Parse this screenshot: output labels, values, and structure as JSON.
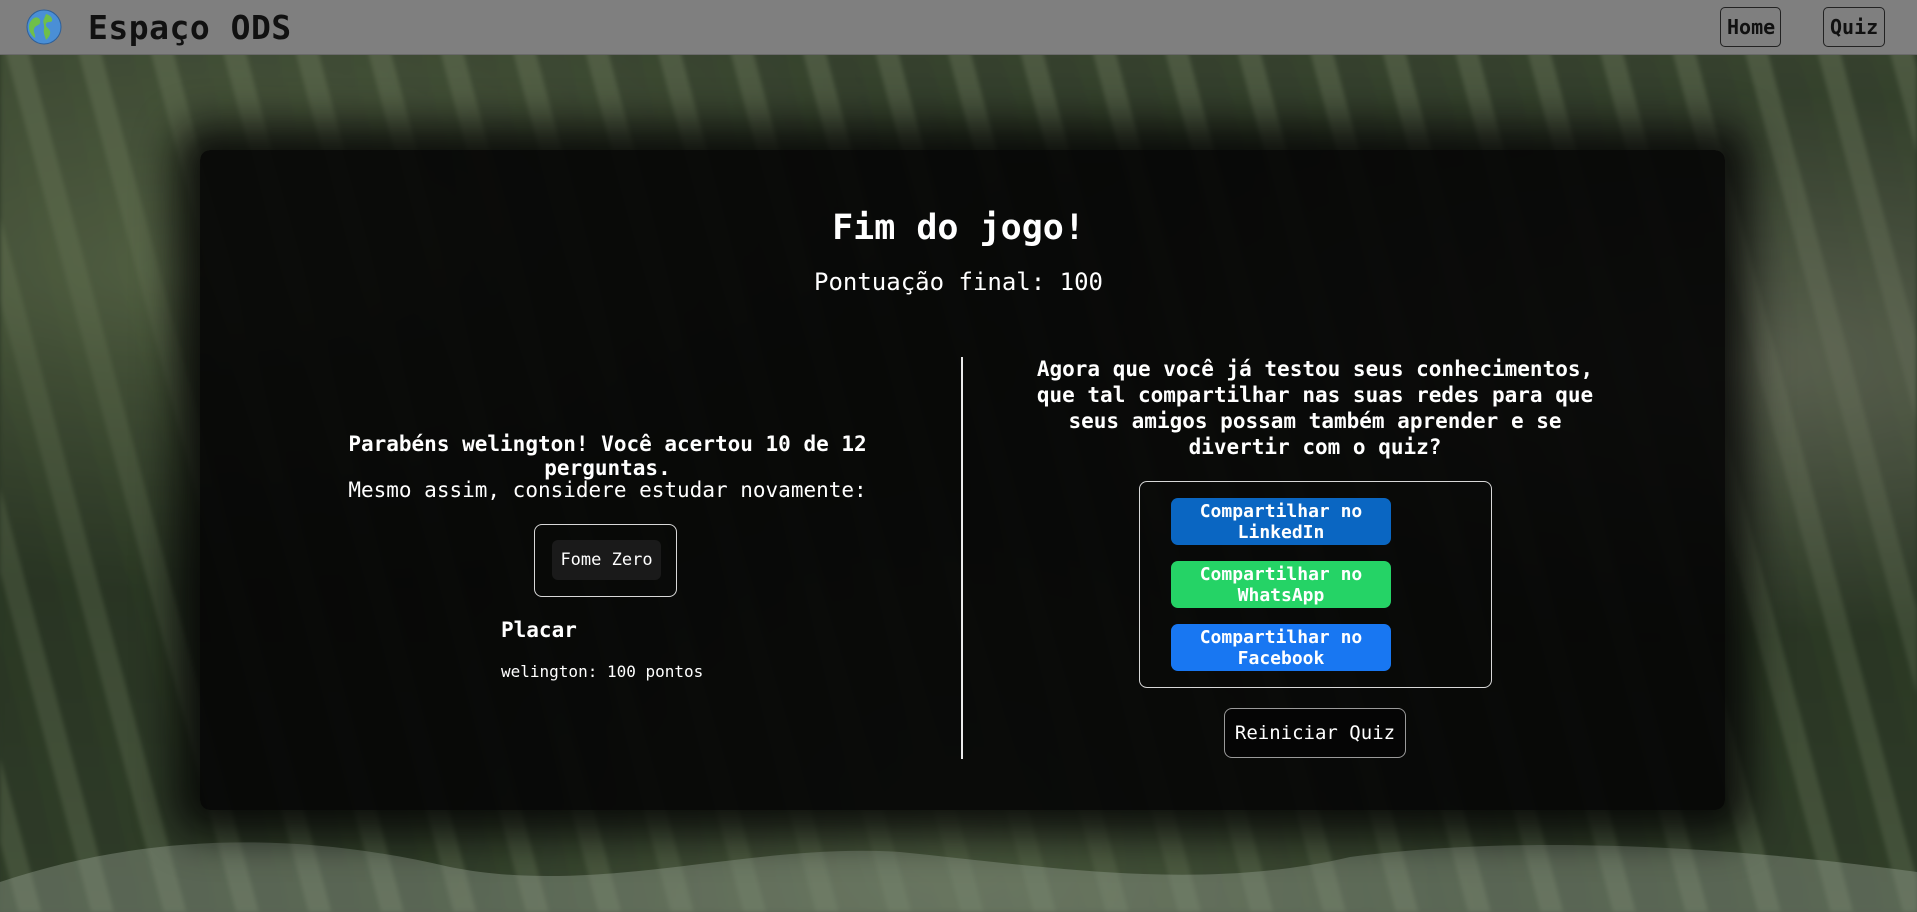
{
  "header": {
    "logo_icon": "globe-icon",
    "brand": "Espaço ODS",
    "nav": {
      "home": "Home",
      "quiz": "Quiz"
    }
  },
  "result": {
    "title": "Fim do jogo!",
    "final_score": "Pontuação final: 100"
  },
  "left": {
    "congrats": "Parabéns welington! Você acertou 10 de 12 perguntas.",
    "study_prompt": "Mesmo assim, considere estudar novamente:",
    "topics": [
      "Fome Zero"
    ],
    "scoreboard_title": "Placar",
    "scoreboard": [
      "welington: 100 pontos"
    ]
  },
  "right": {
    "share_text": "Agora que você já testou seus conhecimentos, que tal compartilhar nas suas redes para que seus amigos possam também aprender e se divertir com o quiz?",
    "share_buttons": {
      "linkedin": "Compartilhar no LinkedIn",
      "whatsapp": "Compartilhar no WhatsApp",
      "facebook": "Compartilhar no Facebook"
    },
    "restart": "Reiniciar Quiz"
  },
  "colors": {
    "linkedin": "#0a66c2",
    "whatsapp": "#25d366",
    "facebook": "#1877f2",
    "topbar": "#7f7f7f"
  }
}
